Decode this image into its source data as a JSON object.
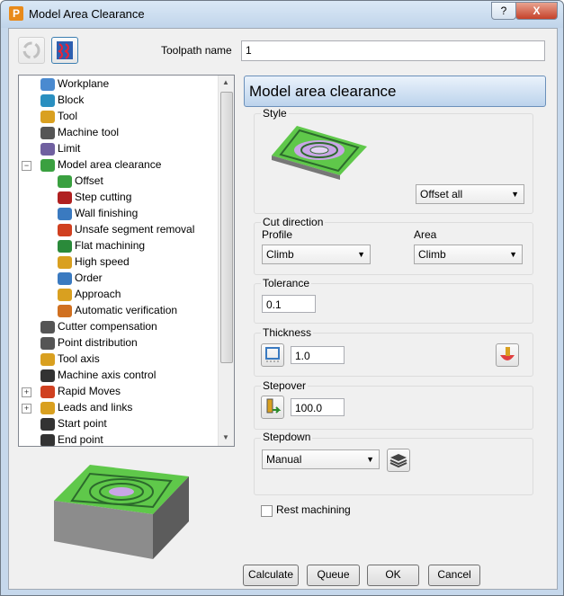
{
  "window": {
    "title": "Model Area Clearance",
    "help_label": "?",
    "close_label": "X",
    "app_icon_letter": "P"
  },
  "toolpath": {
    "name_label": "Toolpath name",
    "name_value": "1"
  },
  "tree": {
    "items": [
      {
        "label": "Workplane",
        "icon": "workplane-icon"
      },
      {
        "label": "Block",
        "icon": "block-icon"
      },
      {
        "label": "Tool",
        "icon": "tool-icon"
      },
      {
        "label": "Machine tool",
        "icon": "machine-tool-icon"
      },
      {
        "label": "Limit",
        "icon": "limit-icon"
      },
      {
        "label": "Model area clearance",
        "icon": "model-area-clearance-icon",
        "expander": "−"
      },
      {
        "label": "Offset",
        "icon": "offset-icon"
      },
      {
        "label": "Step cutting",
        "icon": "step-cutting-icon"
      },
      {
        "label": "Wall finishing",
        "icon": "wall-finishing-icon"
      },
      {
        "label": "Unsafe segment removal",
        "icon": "unsafe-segment-removal-icon"
      },
      {
        "label": "Flat machining",
        "icon": "flat-machining-icon"
      },
      {
        "label": "High speed",
        "icon": "high-speed-icon"
      },
      {
        "label": "Order",
        "icon": "order-icon"
      },
      {
        "label": "Approach",
        "icon": "approach-icon"
      },
      {
        "label": "Automatic verification",
        "icon": "automatic-verification-icon"
      },
      {
        "label": "Cutter compensation",
        "icon": "cutter-compensation-icon"
      },
      {
        "label": "Point distribution",
        "icon": "point-distribution-icon"
      },
      {
        "label": "Tool axis",
        "icon": "tool-axis-icon"
      },
      {
        "label": "Machine axis control",
        "icon": "machine-axis-control-icon"
      },
      {
        "label": "Rapid Moves",
        "icon": "rapid-moves-icon",
        "expander": "+"
      },
      {
        "label": "Leads and links",
        "icon": "leads-and-links-icon",
        "expander": "+"
      },
      {
        "label": "Start point",
        "icon": "start-point-icon"
      },
      {
        "label": "End point",
        "icon": "end-point-icon"
      }
    ]
  },
  "panel": {
    "header": "Model area clearance",
    "style": {
      "label": "Style",
      "value": "Offset all"
    },
    "cut_direction": {
      "label": "Cut direction",
      "profile_label": "Profile",
      "profile_value": "Climb",
      "area_label": "Area",
      "area_value": "Climb"
    },
    "tolerance": {
      "label": "Tolerance",
      "value": "0.1"
    },
    "thickness": {
      "label": "Thickness",
      "value": "1.0"
    },
    "stepover": {
      "label": "Stepover",
      "value": "100.0"
    },
    "stepdown": {
      "label": "Stepdown",
      "value": "Manual"
    },
    "rest_machining": {
      "label": "Rest machining",
      "checked": false
    }
  },
  "buttons": {
    "calculate": "Calculate",
    "queue": "Queue",
    "ok": "OK",
    "cancel": "Cancel"
  },
  "colors": {
    "accent_green": "#5fc84a",
    "accent_purple": "#c9a6e6"
  }
}
